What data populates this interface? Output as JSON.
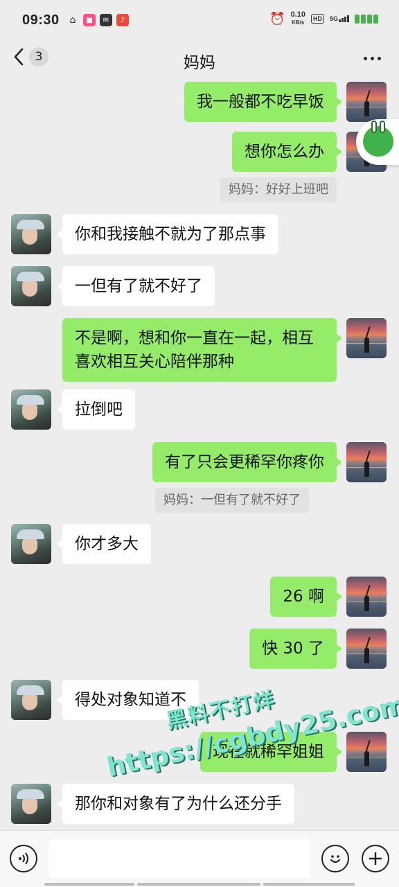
{
  "status_bar": {
    "time": "09:30",
    "net_speed_value": "0.10",
    "net_speed_unit": "KB/s",
    "hd": "HD",
    "network": "5G"
  },
  "nav": {
    "unread_count": "3",
    "title": "妈妈"
  },
  "messages": [
    {
      "side": "right",
      "text": "我一般都不吃早饭"
    },
    {
      "side": "right",
      "text": "想你怎么办"
    },
    {
      "type": "quote",
      "text": "妈妈：好好上班吧"
    },
    {
      "side": "left",
      "text": "你和我接触不就为了那点事"
    },
    {
      "side": "left",
      "text": "一但有了就不好了"
    },
    {
      "side": "right",
      "text": "不是啊，想和你一直在一起，相互喜欢相互关心陪伴那种"
    },
    {
      "side": "left",
      "text": "拉倒吧"
    },
    {
      "side": "right",
      "text": "有了只会更稀罕你疼你"
    },
    {
      "type": "quote",
      "text": "妈妈：一但有了就不好了"
    },
    {
      "side": "left",
      "text": "你才多大"
    },
    {
      "side": "right",
      "text": "26 啊"
    },
    {
      "side": "right",
      "text": "快 30 了"
    },
    {
      "side": "left",
      "text": "得处对象知道不"
    },
    {
      "side": "right",
      "text": "现在就稀罕姐姐"
    },
    {
      "side": "left",
      "text": "那你和对象有了为什么还分手"
    }
  ],
  "watermark": {
    "line1": "黑料不打烊",
    "line2": "https://cgbdy25.com"
  },
  "input": {
    "placeholder": ""
  },
  "colors": {
    "sent_bubble": "#95ec69",
    "received_bubble": "#ffffff",
    "background": "#ededed"
  }
}
